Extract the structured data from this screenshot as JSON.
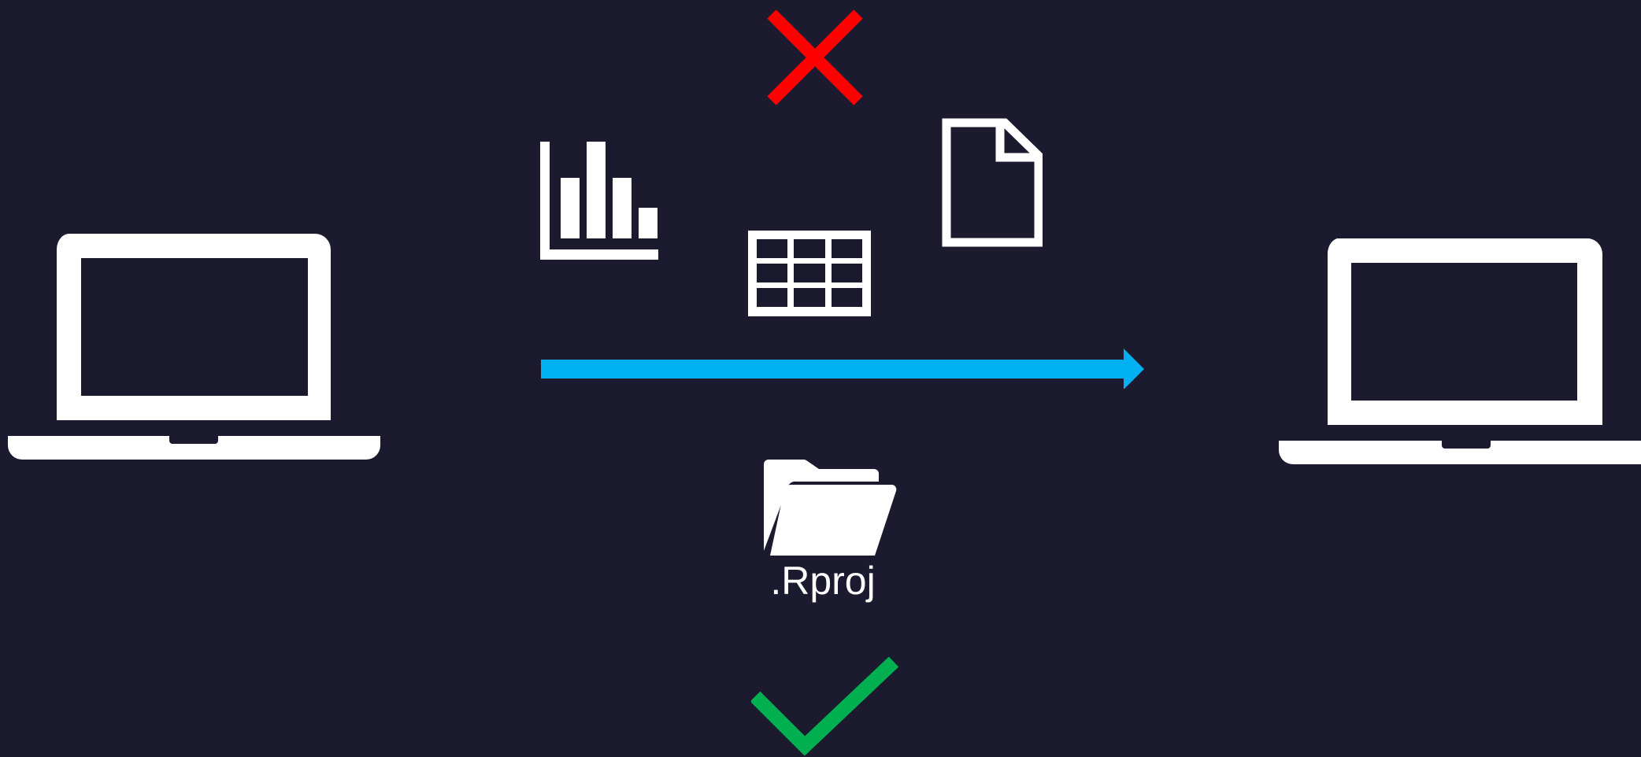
{
  "folder": {
    "label": ".Rproj"
  },
  "icons": {
    "left_device": "laptop-icon",
    "right_device": "laptop-icon",
    "reject": "cross-icon",
    "accept": "checkmark-icon",
    "chart": "bar-chart-icon",
    "table": "table-grid-icon",
    "file": "document-icon",
    "folder": "open-folder-icon",
    "transfer": "right-arrow-icon"
  },
  "colors": {
    "background": "#1c1a2e",
    "foreground": "#ffffff",
    "arrow": "#00b0f0",
    "cross": "#ff0000",
    "check": "#00b050"
  }
}
